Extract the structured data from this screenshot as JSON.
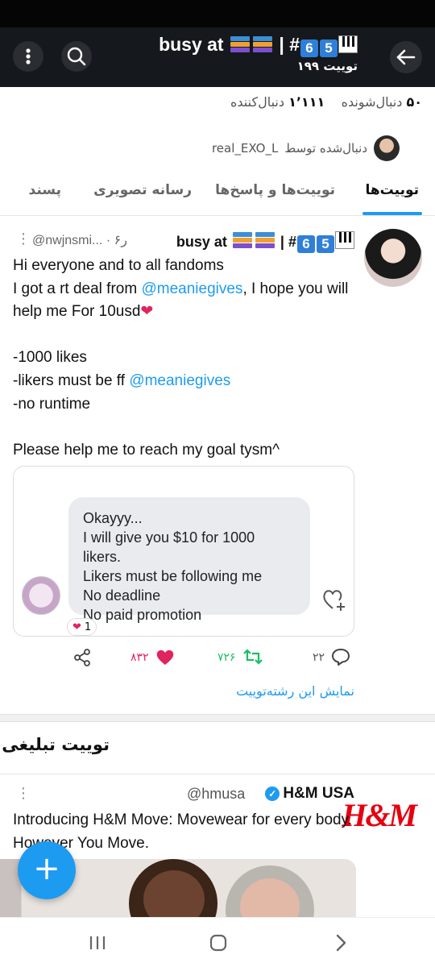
{
  "header": {
    "title_name": "busy at",
    "title_sep": "|",
    "title_hash": "#",
    "title_digits": [
      "6",
      "5"
    ],
    "tweet_count": "۱۹۹ توییت",
    "icons": {
      "more": "more-vertical-icon",
      "search": "search-icon",
      "back": "arrow-left-icon"
    }
  },
  "profile": {
    "following_count": "۵۰",
    "following_label": "دنبال‌شونده",
    "followers_count": "۱٬۱۱۱",
    "followers_label": "دنبال‌کننده",
    "followed_by_label": "دنبال‌شده توسط",
    "followed_by_user": "real_EXO_L"
  },
  "tabs": [
    {
      "label": "توییت‌ها",
      "active": true
    },
    {
      "label": "توییت‌ها و پاسخ‌ها",
      "active": false
    },
    {
      "label": "رسانه تصویری",
      "active": false
    },
    {
      "label": "پسند",
      "active": false
    }
  ],
  "tweet": {
    "name": "busy at",
    "handle_time": "@nwjnsmi... · ۶ر",
    "text_1": "Hi everyone and to all fandoms\nI got a rt deal from ",
    "mention_1": "@meaniegives",
    "text_2": ", I hope you will help me For 10usd",
    "text_3": "\n\n-1000 likes\n-likers must be ff ",
    "mention_2": "@meaniegives",
    "text_4": "\n-no runtime\n\nPlease help me to reach my goal tysm^",
    "quote_message": "Okayyy...\nI will give you $10 for 1000 likers.\nLikers must be following me\nNo deadline\nNo paid promotion",
    "quote_reaction_count": "1",
    "replies": "۲۲",
    "retweets": "۷۲۶",
    "likes": "۸۳۲",
    "show_thread": "نمایش این رشته‌توییت"
  },
  "promoted": {
    "heading": "توییت تبلیغی",
    "name": "H&M USA",
    "handle": "@hmusa",
    "logo_text": "H&M",
    "text": "Introducing H&M Move: Movewear for every body. However You Move."
  },
  "colors": {
    "accent": "#1d9bf0",
    "like": "#e0245e",
    "retweet": "#17bf63",
    "header_bg": "#15181c",
    "brand_hm": "#e50010"
  }
}
